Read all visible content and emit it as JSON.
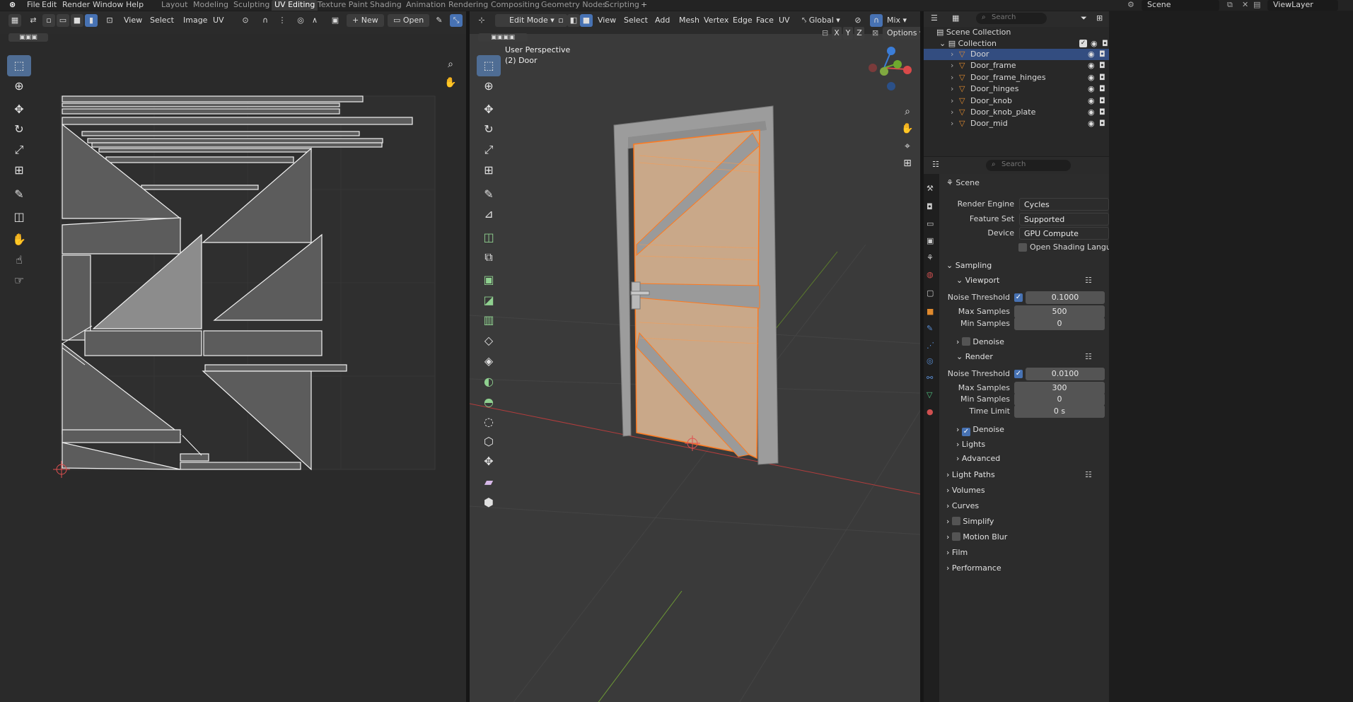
{
  "topbar": {
    "menus": [
      "File",
      "Edit",
      "Render",
      "Window",
      "Help"
    ],
    "workspaces": [
      "Layout",
      "Modeling",
      "Sculpting",
      "UV Editing",
      "Texture Paint",
      "Shading",
      "Animation",
      "Rendering",
      "Compositing",
      "Geometry Nodes",
      "Scripting"
    ],
    "active_workspace": "UV Editing",
    "add_tab": "+",
    "scene_name": "Scene",
    "view_layer": "ViewLayer"
  },
  "uv_editor": {
    "menus": [
      "View",
      "Select",
      "Image",
      "UV"
    ],
    "new_label": "New",
    "open_label": "Open",
    "line_color": "#ffffff",
    "fill_color": "#6d6d6d"
  },
  "viewport": {
    "mode": "Edit Mode",
    "menus": [
      "View",
      "Select",
      "Add",
      "Mesh",
      "Vertex",
      "Edge",
      "Face",
      "UV"
    ],
    "orientation": "Global",
    "shading_mode": "Mix",
    "axes": [
      "X",
      "Y",
      "Z"
    ],
    "options_label": "Options",
    "perspective_label": "User Perspective",
    "object_label": "(2) Door",
    "door_face_color": "#c9a889",
    "selected_edge_color": "#ff7a1f",
    "frame_color": "#a8a8a8"
  },
  "outliner": {
    "search_placeholder": "Search",
    "scene_collection": "Scene Collection",
    "collection": "Collection",
    "objects": [
      "Door",
      "Door_frame",
      "Door_frame_hinges",
      "Door_hinges",
      "Door_knob",
      "Door_knob_plate",
      "Door_mid"
    ],
    "active_object": "Door"
  },
  "properties": {
    "search_placeholder": "Search",
    "context": "Scene",
    "render_engine_label": "Render Engine",
    "render_engine": "Cycles",
    "feature_set_label": "Feature Set",
    "feature_set": "Supported",
    "device_label": "Device",
    "device": "GPU Compute",
    "osl_label": "Open Shading Language",
    "sampling": "Sampling",
    "viewport": "Viewport",
    "noise_threshold_label": "Noise Threshold",
    "max_samples_label": "Max Samples",
    "min_samples_label": "Min Samples",
    "time_limit_label": "Time Limit",
    "denoise_label": "Denoise",
    "viewport_noise_threshold": "0.1000",
    "viewport_max_samples": "500",
    "viewport_min_samples": "0",
    "render": "Render",
    "render_noise_threshold": "0.0100",
    "render_max_samples": "300",
    "render_min_samples": "0",
    "render_time_limit": "0 s",
    "lights": "Lights",
    "advanced": "Advanced",
    "light_paths": "Light Paths",
    "volumes": "Volumes",
    "curves": "Curves",
    "simplify": "Simplify",
    "motion_blur": "Motion Blur",
    "film": "Film",
    "performance": "Performance"
  }
}
